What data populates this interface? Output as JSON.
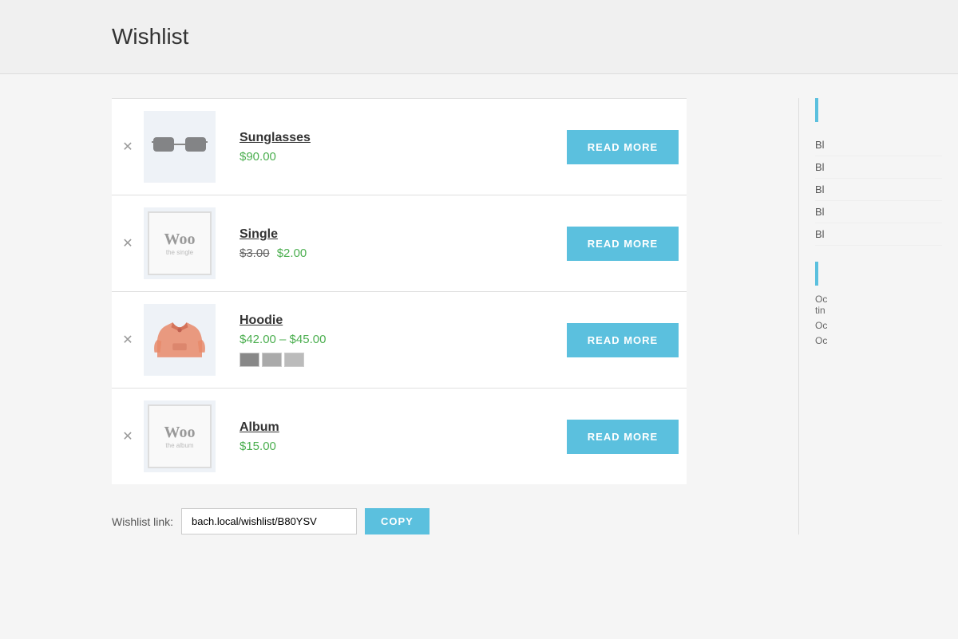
{
  "page": {
    "title": "Wishlist"
  },
  "wishlist": {
    "items": [
      {
        "id": "sunglasses",
        "name": "Sunglasses",
        "price_display": "$90.00",
        "price_type": "single",
        "image_type": "sunglasses",
        "button_label": "READ MORE"
      },
      {
        "id": "single",
        "name": "Single",
        "price_original": "$3.00",
        "price_sale": "$2.00",
        "price_type": "sale",
        "image_type": "woo",
        "woo_subtext": "the single",
        "button_label": "READ MORE"
      },
      {
        "id": "hoodie",
        "name": "Hoodie",
        "price_range": "$42.00 – $45.00",
        "price_type": "range",
        "image_type": "hoodie",
        "swatches": [
          "#888",
          "#aaa",
          "#bbb"
        ],
        "button_label": "READ MORE"
      },
      {
        "id": "album",
        "name": "Album",
        "price_display": "$15.00",
        "price_type": "single",
        "image_type": "woo",
        "woo_subtext": "the album",
        "button_label": "READ MORE"
      }
    ]
  },
  "wishlist_link": {
    "label": "Wishlist link:",
    "value": "bach.local/wishlist/B80YSV",
    "copy_label": "COPY"
  },
  "sidebar": {
    "items": [
      "Bl",
      "Bl",
      "Bl",
      "Bl",
      "Bl"
    ],
    "section2_items": [
      "Oc",
      "Oc",
      "Oc"
    ]
  }
}
